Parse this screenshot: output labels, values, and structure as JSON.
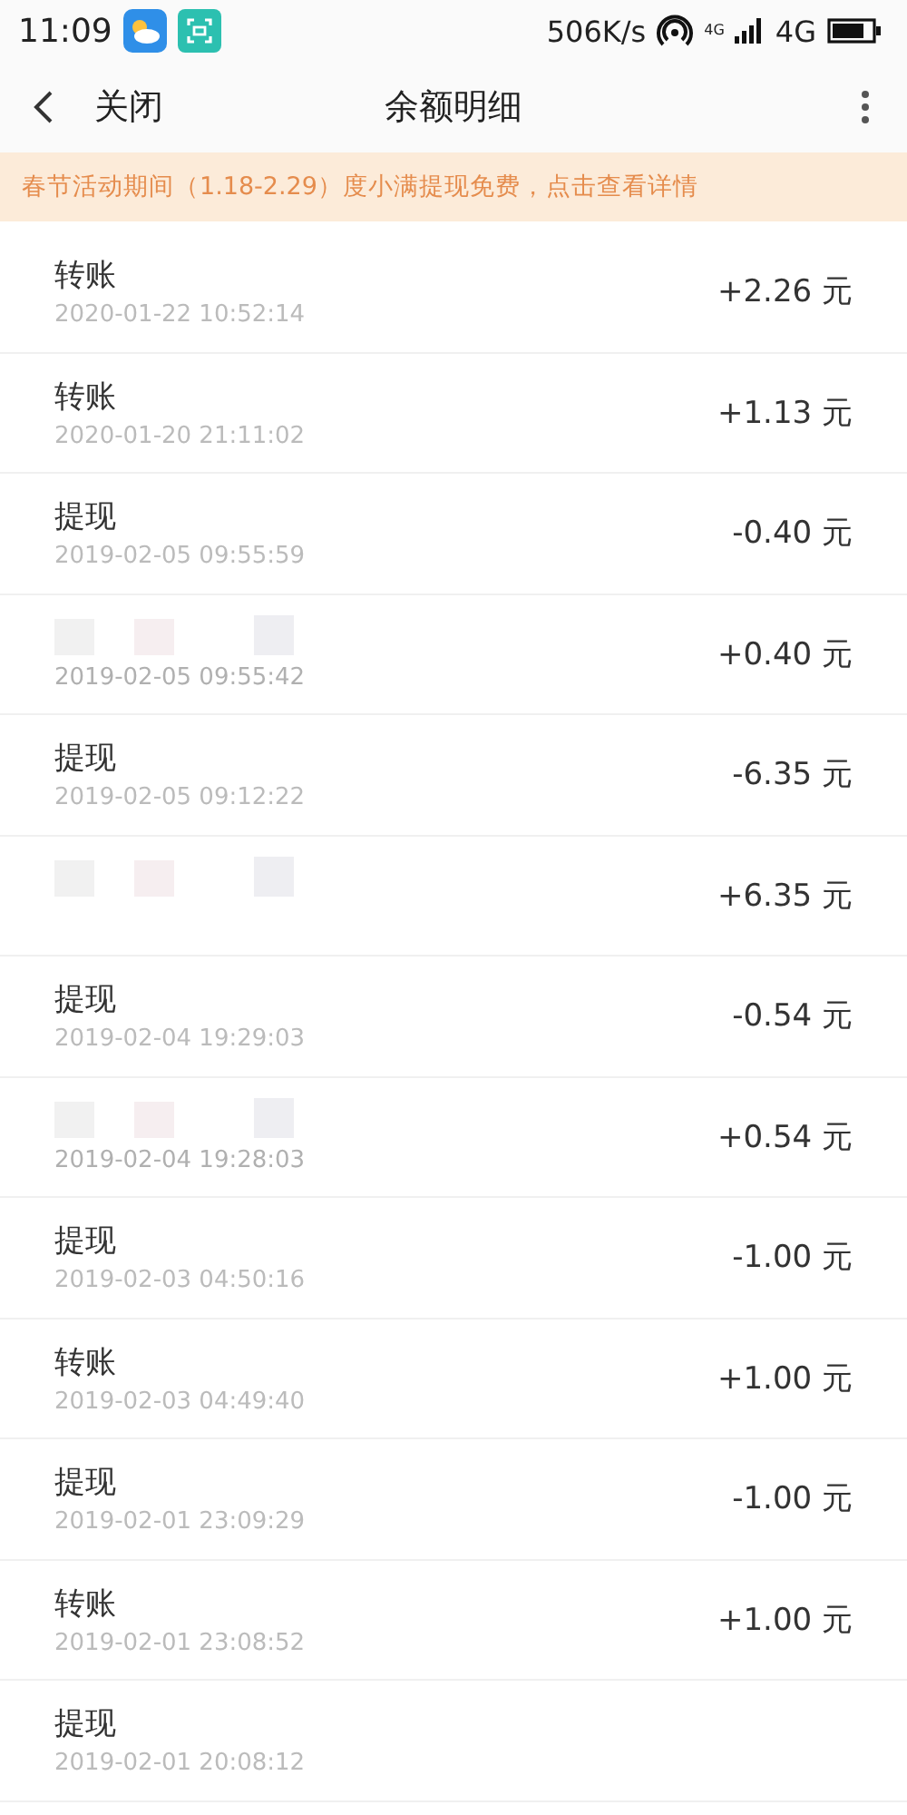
{
  "status_bar": {
    "time": "11:09",
    "speed": "506K/s",
    "net_small": "4G",
    "net": "4G"
  },
  "header": {
    "back": "关闭",
    "title": "余额明细"
  },
  "banner": "春节活动期间（1.18-2.29）度小满提现免费，点击查看详情",
  "rows": [
    {
      "title": "转账",
      "time": "2020-01-22 10:52:14",
      "amount": "+2.26 元"
    },
    {
      "title": "转账",
      "time": "2020-01-20 21:11:02",
      "amount": "+1.13 元"
    },
    {
      "title": "提现",
      "time": "2019-02-05 09:55:59",
      "amount": "-0.40 元"
    },
    {
      "blurred": true,
      "time": "2019-02-05 09:55:42",
      "amount": "+0.40 元"
    },
    {
      "title": "提现",
      "time": "2019-02-05 09:12:22",
      "amount": "-6.35 元"
    },
    {
      "blurred": true,
      "amount": "+6.35 元"
    },
    {
      "title": "提现",
      "time": "2019-02-04 19:29:03",
      "amount": "-0.54 元"
    },
    {
      "blurred": true,
      "time": "2019-02-04 19:28:03",
      "amount": "+0.54 元"
    },
    {
      "title": "提现",
      "time": "2019-02-03 04:50:16",
      "amount": "-1.00 元"
    },
    {
      "title": "转账",
      "time": "2019-02-03 04:49:40",
      "amount": "+1.00 元"
    },
    {
      "title": "提现",
      "time": "2019-02-01 23:09:29",
      "amount": "-1.00 元"
    },
    {
      "title": "转账",
      "time": "2019-02-01 23:08:52",
      "amount": "+1.00 元"
    },
    {
      "title": "提现",
      "time": "2019-02-01 20:08:12"
    }
  ]
}
